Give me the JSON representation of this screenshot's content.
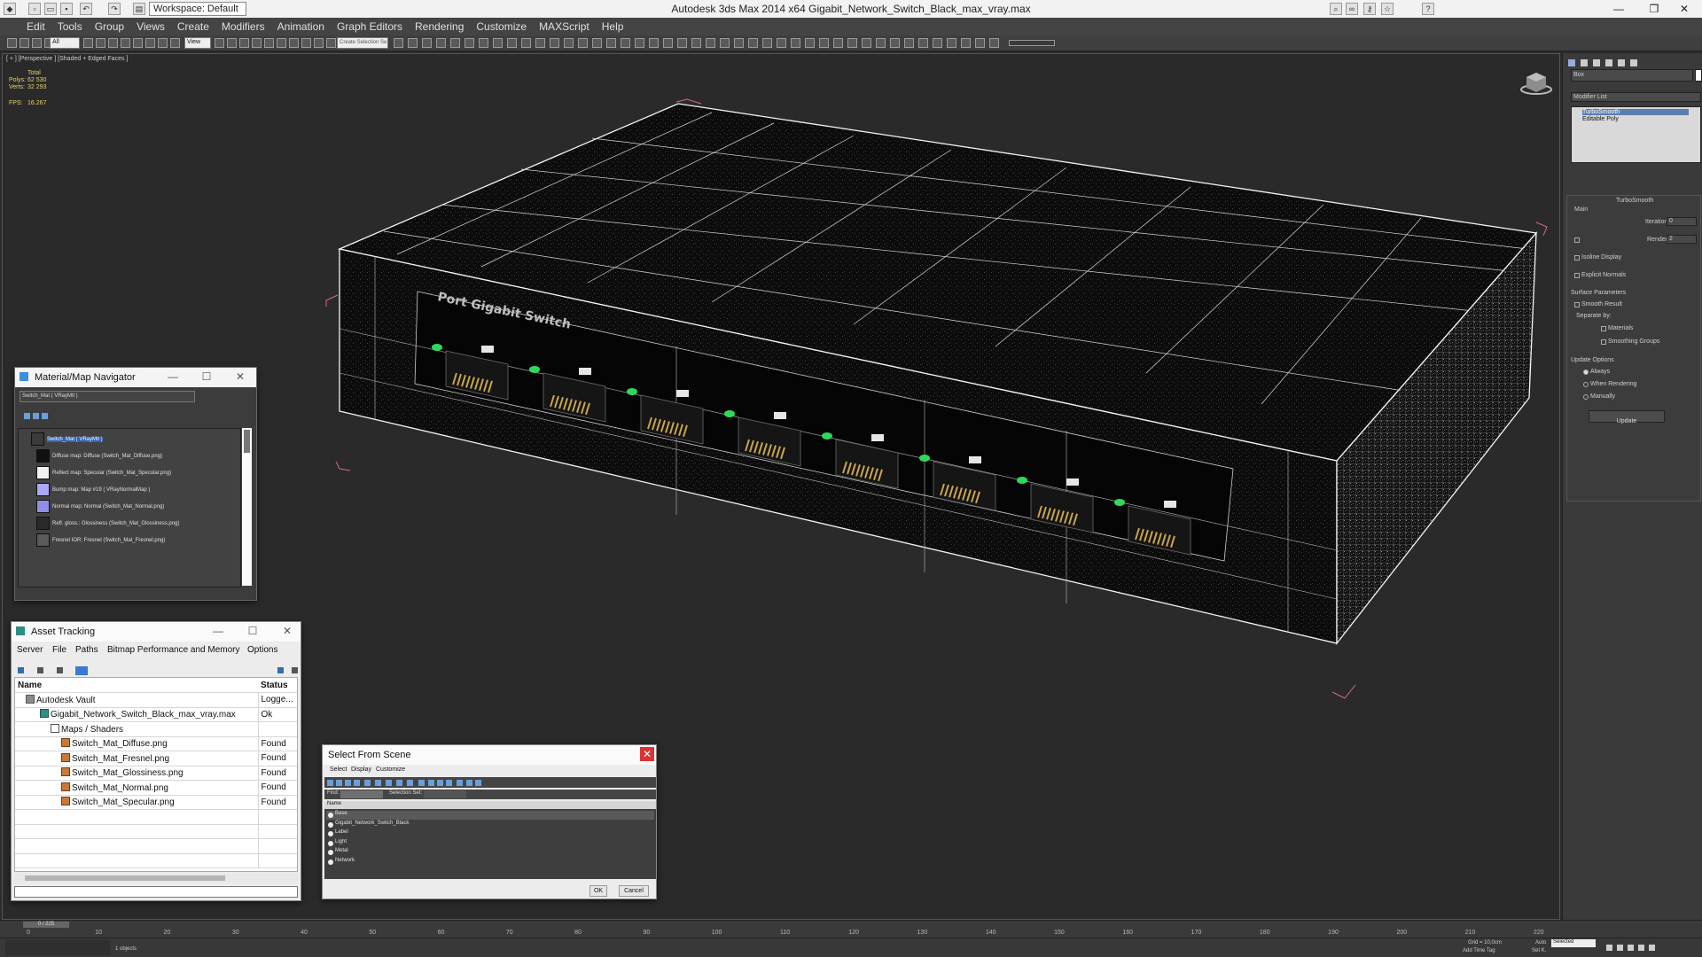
{
  "window": {
    "title": "Autodesk 3ds Max  2014 x64    Gigabit_Network_Switch_Black_max_vray.max",
    "workspace": "Workspace: Default"
  },
  "menu": [
    "Edit",
    "Tools",
    "Group",
    "Views",
    "Create",
    "Modifiers",
    "Animation",
    "Graph Editors",
    "Rendering",
    "Customize",
    "MAXScript",
    "Help"
  ],
  "toolbar": {
    "selection_filter": "All",
    "reference_coord": "View",
    "named_selection": "Create Selection Se"
  },
  "viewport": {
    "label": "[ + ] [Perspective ] [Shaded + Edged Faces ]",
    "stats": {
      "total_label": "Total",
      "polys_label": "Polys:",
      "polys": "62 530",
      "verts_label": "Verts:",
      "verts": "32 293",
      "fps_label": "FPS:",
      "fps": "16.267"
    },
    "model_front_text": "Port Gigabit Switch"
  },
  "command_panel": {
    "object_name": "Box",
    "modifier_list_label": "Modifier List",
    "stack": [
      "TurboSmooth",
      "Editable Poly"
    ],
    "turbosmooth_title": "TurboSmooth",
    "main_label": "Main",
    "iterations_label": "Iterations:",
    "iterations": "0",
    "render_iters_label": "Render Iters:",
    "render_iters": "2",
    "isoline_label": "Isoline Display",
    "explicit_normals_label": "Explicit Normals",
    "surface_params_label": "Surface Parameters",
    "smooth_result_label": "Smooth Result",
    "separate_by_label": "Separate by:",
    "materials_label": "Materials",
    "smoothing_groups_label": "Smoothing Groups",
    "update_options_label": "Update Options",
    "always_label": "Always",
    "when_rendering_label": "When Rendering",
    "manually_label": "Manually",
    "update_button": "Update"
  },
  "material_navigator": {
    "title": "Material/Map Navigator",
    "field": "Switch_Mat  ( VRayMtl )",
    "items": [
      {
        "label": "Switch_Mat  ( VRayMtl )",
        "swatch": "#3a3a3a"
      },
      {
        "label": "Diffuse map: Diffuse (Switch_Mat_Diffuse.png)",
        "swatch": "#101010"
      },
      {
        "label": "Reflect map: Specular (Switch_Mat_Specular.png)",
        "swatch": "#f2f2f2"
      },
      {
        "label": "Bump map: Map #19  ( VRayNormalMap )",
        "swatch": "#a9a9f5"
      },
      {
        "label": "Normal map: Normal (Switch_Mat_Normal.png)",
        "swatch": "#8f8fe8"
      },
      {
        "label": "Refl. gloss.: Glossiness (Switch_Mat_Glossiness.png)",
        "swatch": "#2a2a2a"
      },
      {
        "label": "Fresnel IOR: Fresnel (Switch_Mat_Fresnel.png)",
        "swatch": "#5a5a5a"
      }
    ]
  },
  "asset_tracking": {
    "title": "Asset Tracking",
    "menu": [
      "Server",
      "File",
      "Paths",
      "Bitmap Performance and Memory",
      "Options"
    ],
    "columns": [
      "Name",
      "Status"
    ],
    "rows": [
      {
        "name": "Autodesk Vault",
        "status": "Logge..."
      },
      {
        "name": "Gigabit_Network_Switch_Black_max_vray.max",
        "status": "Ok"
      },
      {
        "name": "Maps / Shaders",
        "status": ""
      },
      {
        "name": "Switch_Mat_Diffuse.png",
        "status": "Found"
      },
      {
        "name": "Switch_Mat_Fresnel.png",
        "status": "Found"
      },
      {
        "name": "Switch_Mat_Glossiness.png",
        "status": "Found"
      },
      {
        "name": "Switch_Mat_Normal.png",
        "status": "Found"
      },
      {
        "name": "Switch_Mat_Specular.png",
        "status": "Found"
      }
    ]
  },
  "select_from_scene": {
    "title": "Select From Scene",
    "menu": [
      "Select",
      "Display",
      "Customize"
    ],
    "find_label": "Find:",
    "selection_set_label": "Selection Set:",
    "column": "Name",
    "objects": [
      "Base",
      "Gigabit_Network_Switch_Black",
      "Label",
      "Light",
      "Metal",
      "Network"
    ],
    "ok_button": "OK",
    "cancel_button": "Cancel"
  },
  "timeline": {
    "frame_counter": "0 / 225",
    "ticks": [
      "0",
      "10",
      "20",
      "30",
      "40",
      "50",
      "60",
      "70",
      "80",
      "90",
      "100",
      "110",
      "120",
      "130",
      "140",
      "150",
      "160",
      "170",
      "180",
      "190",
      "200",
      "210",
      "220"
    ]
  },
  "status": {
    "objects_selected": "1 objects",
    "grid": "Grid = 10,0cm",
    "auto_key": "Auto",
    "set_key": "Set K.",
    "selected": "Selected",
    "add_time_tag": "Add Time Tag"
  },
  "colors": {
    "viewport_bg": "#2a2a2a",
    "ui_panel": "#3a3a3a",
    "led_green": "#2fd85a",
    "selection_bracket": "#d66a86"
  }
}
